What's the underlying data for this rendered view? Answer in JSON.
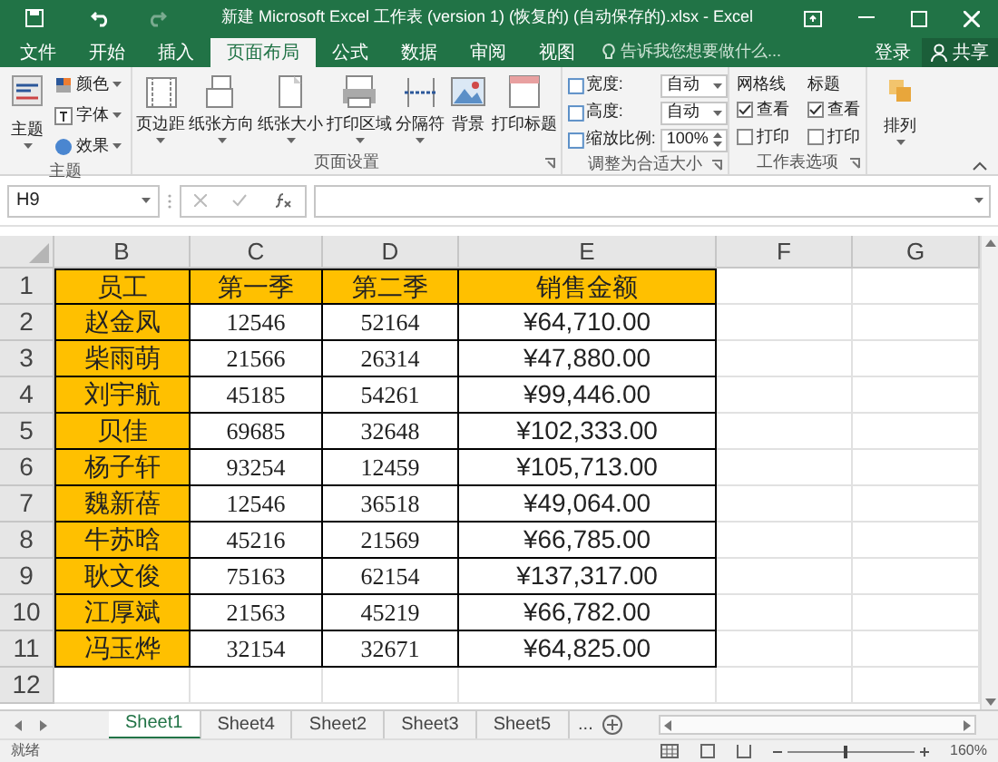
{
  "title_bar": {
    "title": "新建 Microsoft Excel 工作表 (version 1) (恢复的) (自动保存的).xlsx - Excel"
  },
  "ribbon_tabs": [
    {
      "label": "文件",
      "selected": false
    },
    {
      "label": "开始",
      "selected": false
    },
    {
      "label": "插入",
      "selected": false
    },
    {
      "label": "页面布局",
      "selected": true
    },
    {
      "label": "公式",
      "selected": false
    },
    {
      "label": "数据",
      "selected": false
    },
    {
      "label": "审阅",
      "selected": false
    },
    {
      "label": "视图",
      "selected": false
    }
  ],
  "tell_me": {
    "placeholder": "告诉我您想要做什么..."
  },
  "account": {
    "sign_in": "登录",
    "share": "共享"
  },
  "theme_group": {
    "label": "主题",
    "main": "主题",
    "items": [
      "颜色",
      "字体",
      "效果"
    ]
  },
  "page_setup_group": {
    "label": "页面设置",
    "buttons": [
      "页边距",
      "纸张方向",
      "纸张大小",
      "打印区域",
      "分隔符",
      "背景",
      "打印标题"
    ]
  },
  "scale_group": {
    "label": "调整为合适大小",
    "fields": [
      {
        "label": "宽度:",
        "value": "自动"
      },
      {
        "label": "高度:",
        "value": "自动"
      },
      {
        "label": "缩放比例:",
        "value": "100%"
      }
    ]
  },
  "sheet_options_group": {
    "label": "工作表选项",
    "columns": [
      {
        "heading": "网格线",
        "options": [
          {
            "label": "查看",
            "checked": true
          },
          {
            "label": "打印",
            "checked": false
          }
        ]
      },
      {
        "heading": "标题",
        "options": [
          {
            "label": "查看",
            "checked": true
          },
          {
            "label": "打印",
            "checked": false
          }
        ]
      }
    ]
  },
  "arrange": {
    "label": "排列"
  },
  "formula_bar": {
    "name_box": "H9"
  },
  "columns": [
    "B",
    "C",
    "D",
    "E",
    "F",
    "G"
  ],
  "rows": [
    {
      "number": "1",
      "cells": [
        {
          "text": "员工",
          "highlighted": true
        },
        {
          "text": "第一季",
          "highlighted": true
        },
        {
          "text": "第二季",
          "highlighted": true
        },
        {
          "text": "销售金额",
          "highlighted": true
        }
      ]
    },
    {
      "number": "2",
      "cells": [
        {
          "text": "赵金凤",
          "highlighted": true
        },
        {
          "text": "12546",
          "highlighted": false
        },
        {
          "text": "52164",
          "highlighted": false
        },
        {
          "text": "¥64,710.00",
          "highlighted": false
        }
      ]
    },
    {
      "number": "3",
      "cells": [
        {
          "text": "柴雨萌",
          "highlighted": true
        },
        {
          "text": "21566",
          "highlighted": false
        },
        {
          "text": "26314",
          "highlighted": false
        },
        {
          "text": "¥47,880.00",
          "highlighted": false
        }
      ]
    },
    {
      "number": "4",
      "cells": [
        {
          "text": "刘宇航",
          "highlighted": true
        },
        {
          "text": "45185",
          "highlighted": false
        },
        {
          "text": "54261",
          "highlighted": false
        },
        {
          "text": "¥99,446.00",
          "highlighted": false
        }
      ]
    },
    {
      "number": "5",
      "cells": [
        {
          "text": "贝佳",
          "highlighted": true
        },
        {
          "text": "69685",
          "highlighted": false
        },
        {
          "text": "32648",
          "highlighted": false
        },
        {
          "text": "¥102,333.00",
          "highlighted": false
        }
      ]
    },
    {
      "number": "6",
      "cells": [
        {
          "text": "杨子轩",
          "highlighted": true
        },
        {
          "text": "93254",
          "highlighted": false
        },
        {
          "text": "12459",
          "highlighted": false
        },
        {
          "text": "¥105,713.00",
          "highlighted": false
        }
      ]
    },
    {
      "number": "7",
      "cells": [
        {
          "text": "魏新蓓",
          "highlighted": true
        },
        {
          "text": "12546",
          "highlighted": false
        },
        {
          "text": "36518",
          "highlighted": false
        },
        {
          "text": "¥49,064.00",
          "highlighted": false
        }
      ]
    },
    {
      "number": "8",
      "cells": [
        {
          "text": "牛苏晗",
          "highlighted": true
        },
        {
          "text": "45216",
          "highlighted": false
        },
        {
          "text": "21569",
          "highlighted": false
        },
        {
          "text": "¥66,785.00",
          "highlighted": false
        }
      ]
    },
    {
      "number": "9",
      "cells": [
        {
          "text": "耿文俊",
          "highlighted": true
        },
        {
          "text": "75163",
          "highlighted": false
        },
        {
          "text": "62154",
          "highlighted": false
        },
        {
          "text": "¥137,317.00",
          "highlighted": false
        }
      ]
    },
    {
      "number": "10",
      "cells": [
        {
          "text": "江厚斌",
          "highlighted": true
        },
        {
          "text": "21563",
          "highlighted": false
        },
        {
          "text": "45219",
          "highlighted": false
        },
        {
          "text": "¥66,782.00",
          "highlighted": false
        }
      ]
    },
    {
      "number": "11",
      "cells": [
        {
          "text": "冯玉烨",
          "highlighted": true
        },
        {
          "text": "32154",
          "highlighted": false
        },
        {
          "text": "32671",
          "highlighted": false
        },
        {
          "text": "¥64,825.00",
          "highlighted": false
        }
      ]
    },
    {
      "number": "12",
      "cells": []
    }
  ],
  "sheet_tabs": [
    {
      "label": "Sheet1",
      "selected": true
    },
    {
      "label": "Sheet4",
      "selected": false
    },
    {
      "label": "Sheet2",
      "selected": false
    },
    {
      "label": "Sheet3",
      "selected": false
    },
    {
      "label": "Sheet5",
      "selected": false
    }
  ],
  "more_sheets": "...",
  "status_bar": {
    "status": "就绪",
    "zoom_slider": {
      "level": 0.47
    },
    "zoom": "160%"
  }
}
